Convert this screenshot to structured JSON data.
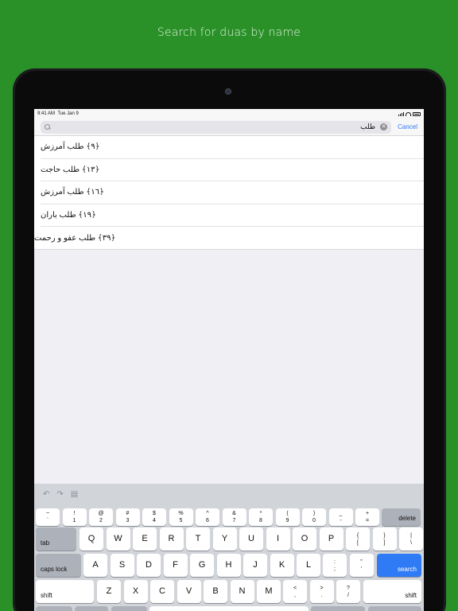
{
  "headline": "Search for duas by name",
  "status": {
    "time": "9:41 AM",
    "date": "Tue Jan 9"
  },
  "search": {
    "query": "طلب",
    "clear_icon": "clear-icon",
    "cancel_label": "Cancel"
  },
  "results": [
    "﴿٩﴾ طلب آمرزش",
    "﴿١٣﴾ طلب حاجت",
    "﴿١٦﴾ طلب آمرزش",
    "﴿١٩﴾ طلب باران",
    "﴿٣٩﴾ طلب عفو و رحمت"
  ],
  "keyboard": {
    "toolbar_icons": [
      "undo-icon",
      "redo-icon",
      "paste-icon"
    ],
    "row1": [
      {
        "top": "~",
        "bottom": "`"
      },
      {
        "top": "!",
        "bottom": "1"
      },
      {
        "top": "@",
        "bottom": "2"
      },
      {
        "top": "#",
        "bottom": "3"
      },
      {
        "top": "$",
        "bottom": "4"
      },
      {
        "top": "%",
        "bottom": "5"
      },
      {
        "top": "^",
        "bottom": "6"
      },
      {
        "top": "&",
        "bottom": "7"
      },
      {
        "top": "*",
        "bottom": "8"
      },
      {
        "top": "(",
        "bottom": "9"
      },
      {
        "top": ")",
        "bottom": "0"
      },
      {
        "top": "_",
        "bottom": "-"
      },
      {
        "top": "+",
        "bottom": "="
      }
    ],
    "delete_label": "delete",
    "tab_label": "tab",
    "row2": [
      "Q",
      "W",
      "E",
      "R",
      "T",
      "Y",
      "U",
      "I",
      "O",
      "P"
    ],
    "row2_sym": [
      {
        "top": "{",
        "bottom": "["
      },
      {
        "top": "}",
        "bottom": "]"
      },
      {
        "top": "|",
        "bottom": "\\"
      }
    ],
    "caps_label": "caps lock",
    "row3": [
      "A",
      "S",
      "D",
      "F",
      "G",
      "H",
      "J",
      "K",
      "L"
    ],
    "row3_sym": [
      {
        "top": ":",
        "bottom": ";"
      },
      {
        "top": "\"",
        "bottom": "'"
      }
    ],
    "search_label": "search",
    "shift_label": "shift",
    "row4": [
      "Z",
      "X",
      "C",
      "V",
      "B",
      "N",
      "M"
    ],
    "row4_sym": [
      {
        "top": "<",
        "bottom": ","
      },
      {
        "top": ">",
        "bottom": "."
      },
      {
        "top": "?",
        "bottom": "/"
      }
    ],
    "shift_right_label": "shift"
  }
}
